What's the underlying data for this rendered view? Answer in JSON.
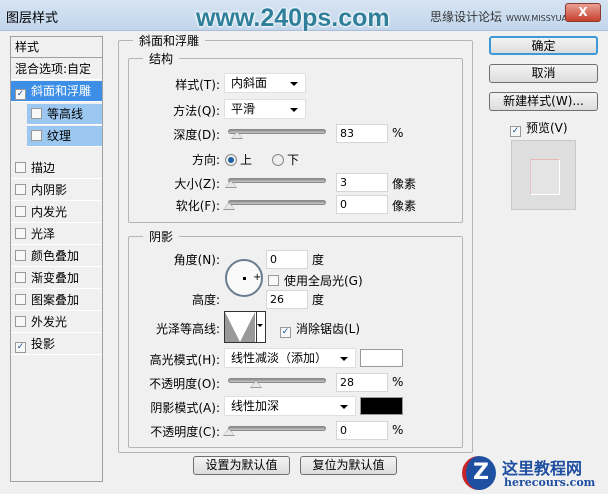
{
  "window": {
    "title": "图层样式",
    "close": "X"
  },
  "watermarks": {
    "top": "www.240ps.com",
    "forum": "思缘设计论坛",
    "forum_url": "WWW.MISSYUAN.COM",
    "logo_cn": "这里教程网",
    "logo_url": "herecours.com"
  },
  "sidebar": {
    "header": "样式",
    "blend": "混合选项:自定",
    "items": [
      {
        "label": "斜面和浮雕",
        "checked": true,
        "selected": true
      },
      {
        "label": "等高线",
        "checked": false,
        "sub": true
      },
      {
        "label": "纹理",
        "checked": false,
        "sub": true
      },
      {
        "label": "描边",
        "checked": false
      },
      {
        "label": "内阴影",
        "checked": false
      },
      {
        "label": "内发光",
        "checked": false
      },
      {
        "label": "光泽",
        "checked": false
      },
      {
        "label": "颜色叠加",
        "checked": false
      },
      {
        "label": "渐变叠加",
        "checked": false
      },
      {
        "label": "图案叠加",
        "checked": false
      },
      {
        "label": "外发光",
        "checked": false
      },
      {
        "label": "投影",
        "checked": true
      }
    ]
  },
  "bevel": {
    "title": "斜面和浮雕",
    "structure": {
      "title": "结构",
      "style_label": "样式(T):",
      "style_value": "内斜面",
      "technique_label": "方法(Q):",
      "technique_value": "平滑",
      "depth_label": "深度(D):",
      "depth_value": "83",
      "depth_unit": "%",
      "depth_pct": 0.08,
      "direction_label": "方向:",
      "dir_up": "上",
      "dir_down": "下",
      "size_label": "大小(Z):",
      "size_value": "3",
      "size_unit": "像素",
      "size_pct": 0.02,
      "soften_label": "软化(F):",
      "soften_value": "0",
      "soften_unit": "像素",
      "soften_pct": 0
    }
  },
  "shading": {
    "title": "阴影",
    "angle_label": "角度(N):",
    "angle_value": "0",
    "angle_unit": "度",
    "global_light": "使用全局光(G)",
    "altitude_label": "高度:",
    "altitude_value": "26",
    "altitude_unit": "度",
    "gloss_label": "光泽等高线:",
    "antialias": "消除锯齿(L)",
    "highlight_label": "高光模式(H):",
    "highlight_value": "线性减淡（添加）",
    "highlight_color": "#ffffff",
    "hl_opacity_label": "不透明度(O):",
    "hl_opacity_value": "28",
    "hl_pct": 0.28,
    "pct": "%",
    "shadow_label": "阴影模式(A):",
    "shadow_value": "线性加深",
    "shadow_color": "#000000",
    "sh_opacity_label": "不透明度(C):",
    "sh_opacity_value": "0",
    "sh_pct": 0
  },
  "buttons": {
    "make_default": "设置为默认值",
    "reset_default": "复位为默认值",
    "ok": "确定",
    "cancel": "取消",
    "new_style": "新建样式(W)...",
    "preview": "预览(V)"
  }
}
